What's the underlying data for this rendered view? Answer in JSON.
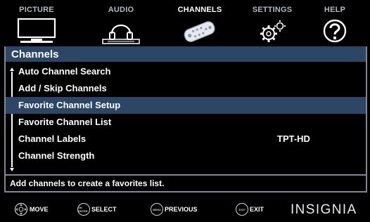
{
  "tabs": [
    {
      "label": "PICTURE",
      "icon": "tv-icon"
    },
    {
      "label": "AUDIO",
      "icon": "headphones-icon"
    },
    {
      "label": "CHANNELS",
      "icon": "remote-icon",
      "active": true
    },
    {
      "label": "SETTINGS",
      "icon": "gears-icon"
    },
    {
      "label": "HELP",
      "icon": "question-icon"
    }
  ],
  "panel": {
    "title": "Channels",
    "items": [
      {
        "label": "Auto Channel Search",
        "value": ""
      },
      {
        "label": "Add / Skip Channels",
        "value": ""
      },
      {
        "label": "Favorite Channel Setup",
        "value": "",
        "selected": true
      },
      {
        "label": "Favorite Channel List",
        "value": ""
      },
      {
        "label": "Channel Labels",
        "value": "TPT-HD"
      },
      {
        "label": "Channel Strength",
        "value": ""
      }
    ]
  },
  "help_text": "Add channels to create a favorites list.",
  "bottom_bar": {
    "move_label": "MOVE",
    "select_label": "SELECT",
    "select_key_text": "OK ENTER",
    "previous_label": "PREVIOUS",
    "previous_key_text": "MENU",
    "exit_label": "EXIT",
    "exit_key_text": "EXIT",
    "brand": "INSIGNIA"
  },
  "colors": {
    "highlight": "#2c4766",
    "frame": "#7d8796",
    "tab_inactive": "#b4b8c0",
    "text": "#ffffff"
  }
}
